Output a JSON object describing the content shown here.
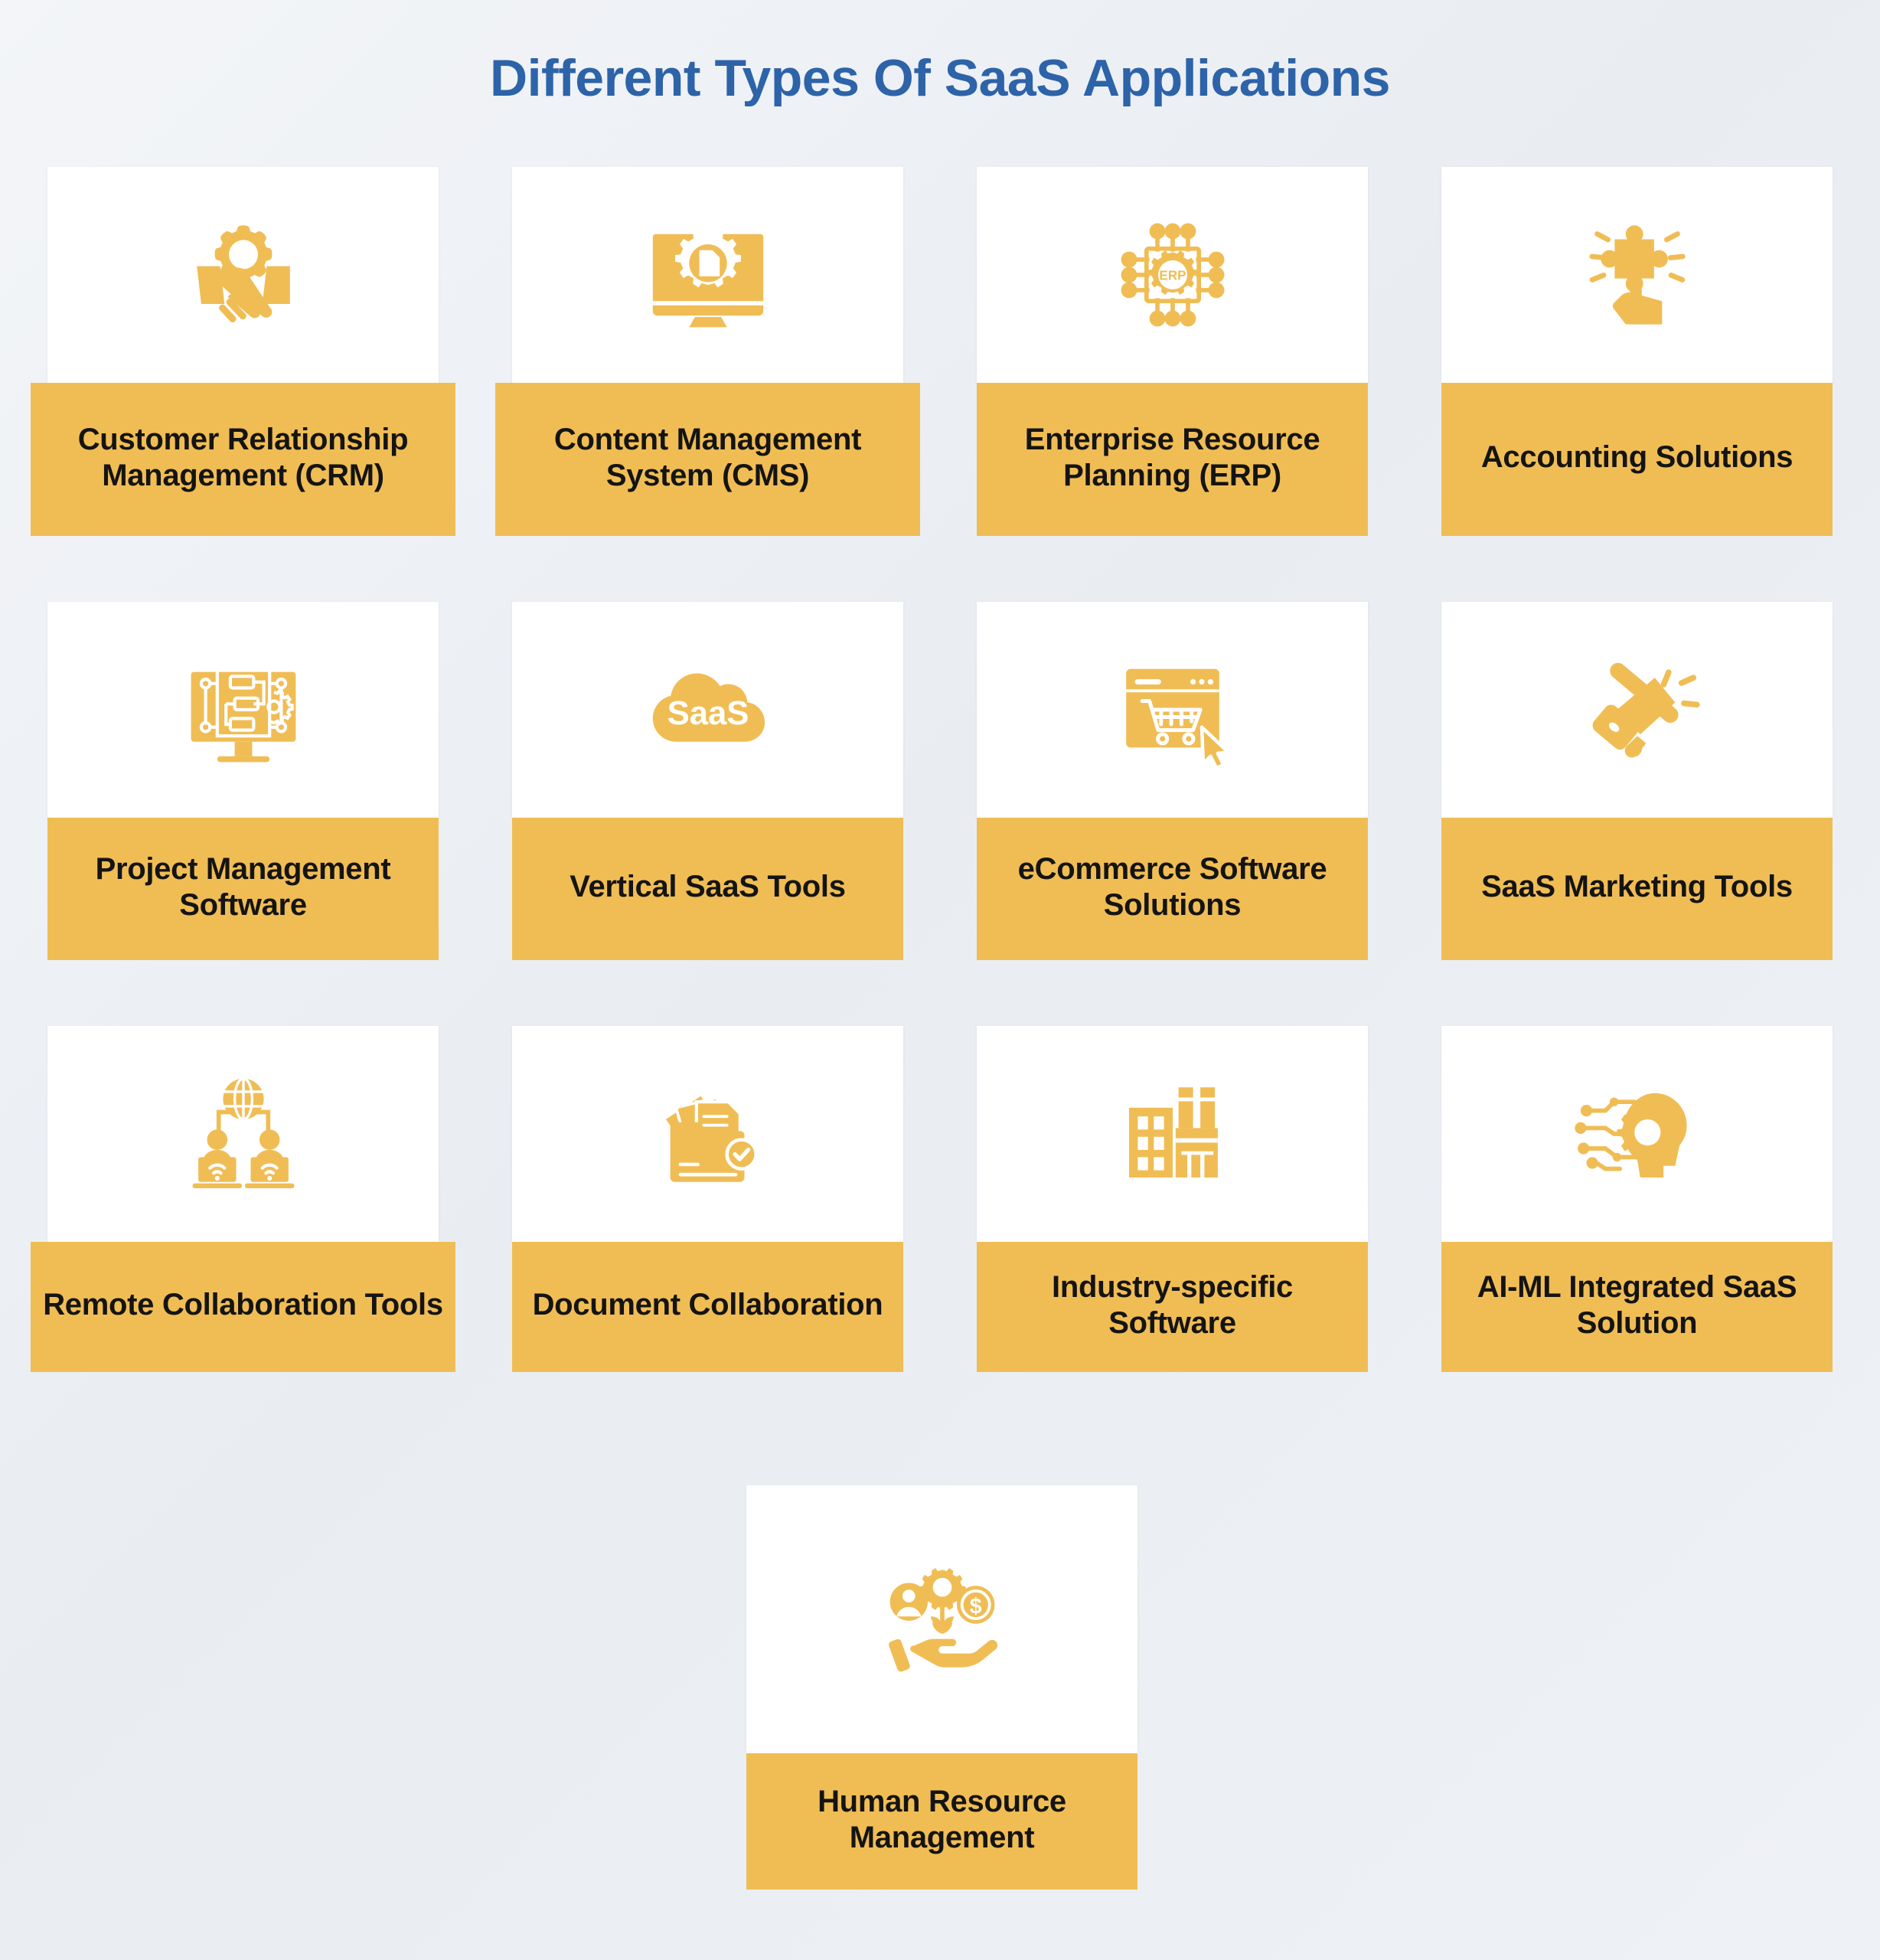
{
  "header": {
    "title": "Different Types Of SaaS Applications",
    "title_color": "#2d63a8"
  },
  "theme": {
    "band_color": "#f0bd55",
    "icon_color": "#f0bd55",
    "card_surface": "#ffffff",
    "page_background": "#eef1f5",
    "label_color": "#141414"
  },
  "cards": [
    {
      "id": 1,
      "icon": "handshake-gear-icon",
      "label": "Customer Relationship Management (CRM)"
    },
    {
      "id": 2,
      "icon": "monitor-gear-document-icon",
      "label": "Content Management System (CMS)"
    },
    {
      "id": 3,
      "icon": "cpu-chip-erp-icon",
      "label": "Enterprise Resource Planning (ERP)",
      "icon_text": "ERP"
    },
    {
      "id": 4,
      "icon": "hand-puzzle-piece-icon",
      "label": "Accounting Solutions"
    },
    {
      "id": 5,
      "icon": "monitor-flowchart-gear-icon",
      "label": "Project Management Software"
    },
    {
      "id": 6,
      "icon": "cloud-saas-icon",
      "label": "Vertical SaaS Tools",
      "icon_text": "SaaS"
    },
    {
      "id": 7,
      "icon": "browser-shopping-cart-cursor-icon",
      "label": "eCommerce Software Solutions"
    },
    {
      "id": 8,
      "icon": "megaphone-icon",
      "label": "SaaS Marketing Tools"
    },
    {
      "id": 9,
      "icon": "globe-people-laptops-wifi-icon",
      "label": "Remote Collaboration Tools"
    },
    {
      "id": 10,
      "icon": "folder-documents-check-icon",
      "label": "Document Collaboration"
    },
    {
      "id": 11,
      "icon": "factory-building-icon",
      "label": "Industry-specific Software"
    },
    {
      "id": 12,
      "icon": "ai-head-gear-circuit-icon",
      "label": "AI-ML Integrated SaaS Solution"
    },
    {
      "id": 13,
      "icon": "hand-person-gear-dollar-icon",
      "label": "Human Resource Management"
    }
  ]
}
